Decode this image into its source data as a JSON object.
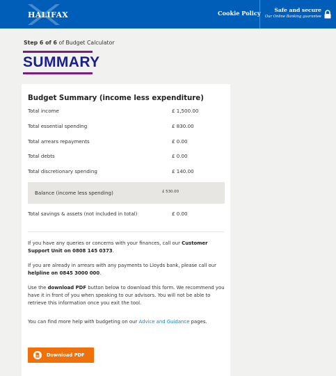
{
  "header": {
    "brand": "HALIFAX",
    "cookie_policy": "Cookie Policy",
    "safe_title": "Safe and secure",
    "safe_subtitle": "Our Online Banking guarantee"
  },
  "page": {
    "step_current": "Step 6 of 6",
    "step_suffix": "of Budget Calculator",
    "title": "SUMMARY"
  },
  "summary": {
    "heading": "Budget Summary (income less expenditure)",
    "rows": [
      {
        "label": "Total income",
        "value": "£ 1,500.00"
      },
      {
        "label": "Total essential spending",
        "value": "£ 830.00"
      },
      {
        "label": "Total arrears repayments",
        "value": "£ 0.00"
      },
      {
        "label": "Total debts",
        "value": "£ 0.00"
      },
      {
        "label": "Total discretionary spending",
        "value": "£ 140.00"
      }
    ],
    "balance": {
      "label": "Balance (income less spending)",
      "value": "£ 530.00"
    },
    "savings": {
      "label": "Total savings & assets (not included in total)",
      "value": "£ 0.00"
    }
  },
  "info": {
    "p1_a": "If you have any queries or concerns with your finances, call our ",
    "p1_b": "Customer Support Unit on 0808 145 0373",
    "p1_c": ".",
    "p2_a": "If you are already in arrears with any payments to Lloyds bank, please call our ",
    "p2_b": "helpline on 0845 3000 000",
    "p2_c": ".",
    "p3_a": "Use the ",
    "p3_b": "download PDF",
    "p3_c": " button below to download this form. We recommend you have it in front of you when speaking to our advisors. You will not be able to retrieve this information once you exit the tool.",
    "p4_a": "You can find more help with budgeting on our ",
    "p4_link": "Advice and Guidance",
    "p4_c": " pages."
  },
  "download": {
    "label": "Download PDF",
    "icon": "pdf-icon"
  },
  "colors": {
    "header": "#005eb8",
    "accent_purple": "#7b1c7e",
    "title_blue": "#1a1f8c",
    "button_orange": "#f0700a",
    "link": "#1a7fc6"
  }
}
